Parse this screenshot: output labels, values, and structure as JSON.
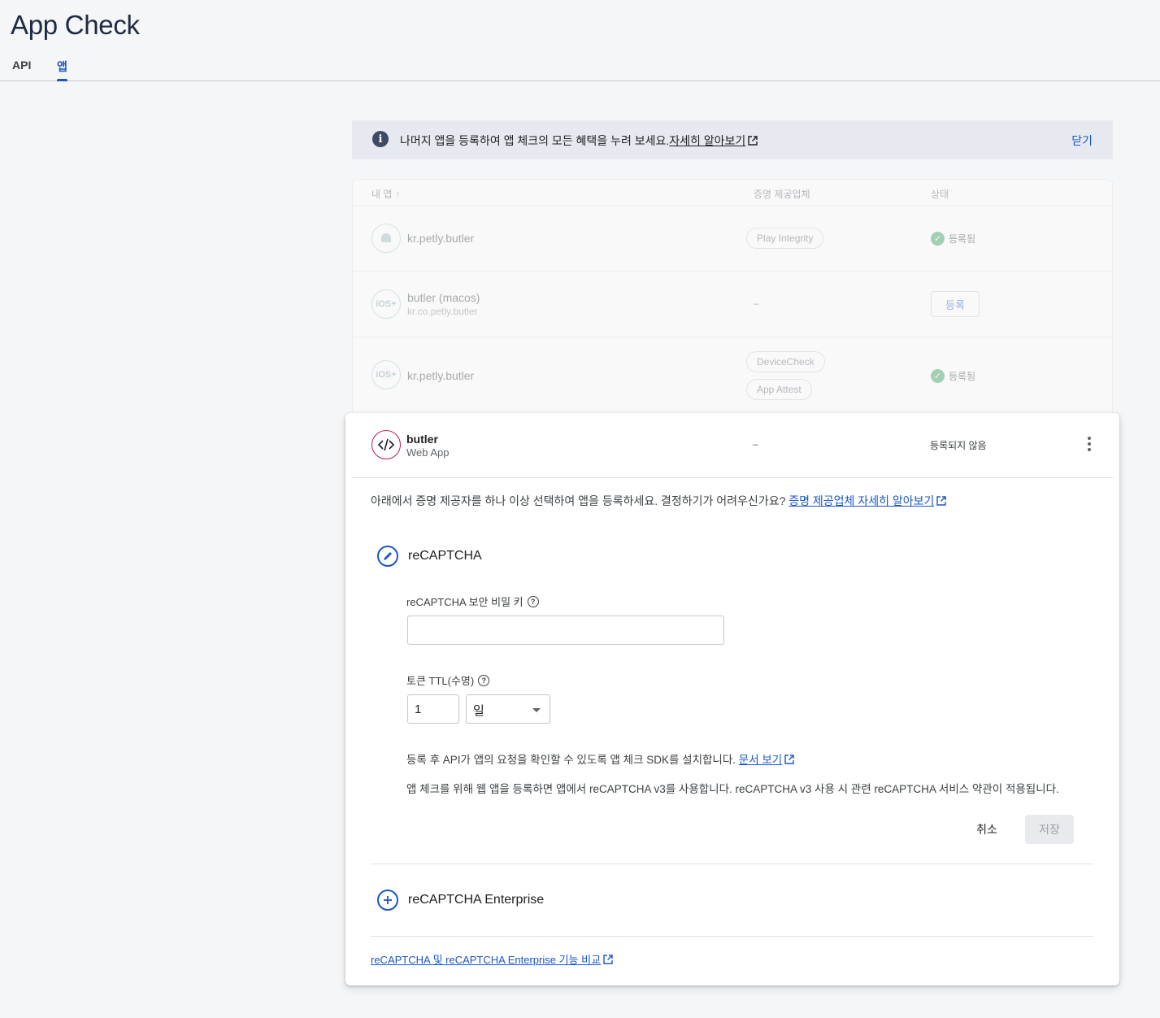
{
  "page": {
    "title": "App Check"
  },
  "tabs": [
    {
      "label": "API"
    },
    {
      "label": "앱",
      "active": true
    }
  ],
  "banner": {
    "text": "나머지 앱을 등록하여 앱 체크의 모든 혜택을 누려 보세요.",
    "link": "자세히 알아보기",
    "close": "닫기"
  },
  "table": {
    "headers": {
      "app": "내 앱",
      "provider": "증명 제공업체",
      "status": "상태"
    },
    "rows": [
      {
        "name": "kr.petly.butler",
        "icon": "android-icon",
        "providers": [
          "Play Integrity"
        ],
        "status": "등록됨"
      },
      {
        "name": "butler (macos)",
        "sub": "kr.co.petly.butler",
        "icon_text": "iOS+",
        "provider_dash": "–",
        "action": "등록"
      },
      {
        "name": "kr.petly.butler",
        "icon_text": "iOS+",
        "providers": [
          "DeviceCheck",
          "App Attest"
        ],
        "status": "등록됨"
      }
    ]
  },
  "panel": {
    "app": {
      "name": "butler",
      "sub": "Web App",
      "provider_dash": "–",
      "status": "등록되지 않음"
    },
    "intro": "아래에서 증명 제공자를 하나 이상 선택하여 앱을 등록하세요. 결정하기가 어려우신가요?",
    "intro_link": "증명 제공업체 자세히 알아보기",
    "recaptcha": {
      "title": "reCAPTCHA",
      "secret_label": "reCAPTCHA 보안 비밀 키",
      "secret_value": "",
      "ttl_label": "토큰 TTL(수명)",
      "ttl_value": "1",
      "ttl_unit": "일",
      "note1": "등록 후 API가 앱의 요청을 확인할 수 있도록 앱 체크 SDK를 설치합니다.",
      "note1_link": "문서 보기",
      "note2": "앱 체크를 위해 웹 앱을 등록하면 앱에서 reCAPTCHA v3를 사용합니다. reCAPTCHA v3 사용 시 관련 reCAPTCHA 서비스 약관이 적용됩니다.",
      "cancel": "취소",
      "save": "저장"
    },
    "enterprise": {
      "title": "reCAPTCHA Enterprise"
    },
    "compare_link": "reCAPTCHA 및 reCAPTCHA Enterprise 기능 비교"
  },
  "colors": {
    "accent": "#1a56c8",
    "success": "#2e9e56",
    "web_icon": "#b81e55",
    "banner_bg": "#e6e9ef"
  }
}
